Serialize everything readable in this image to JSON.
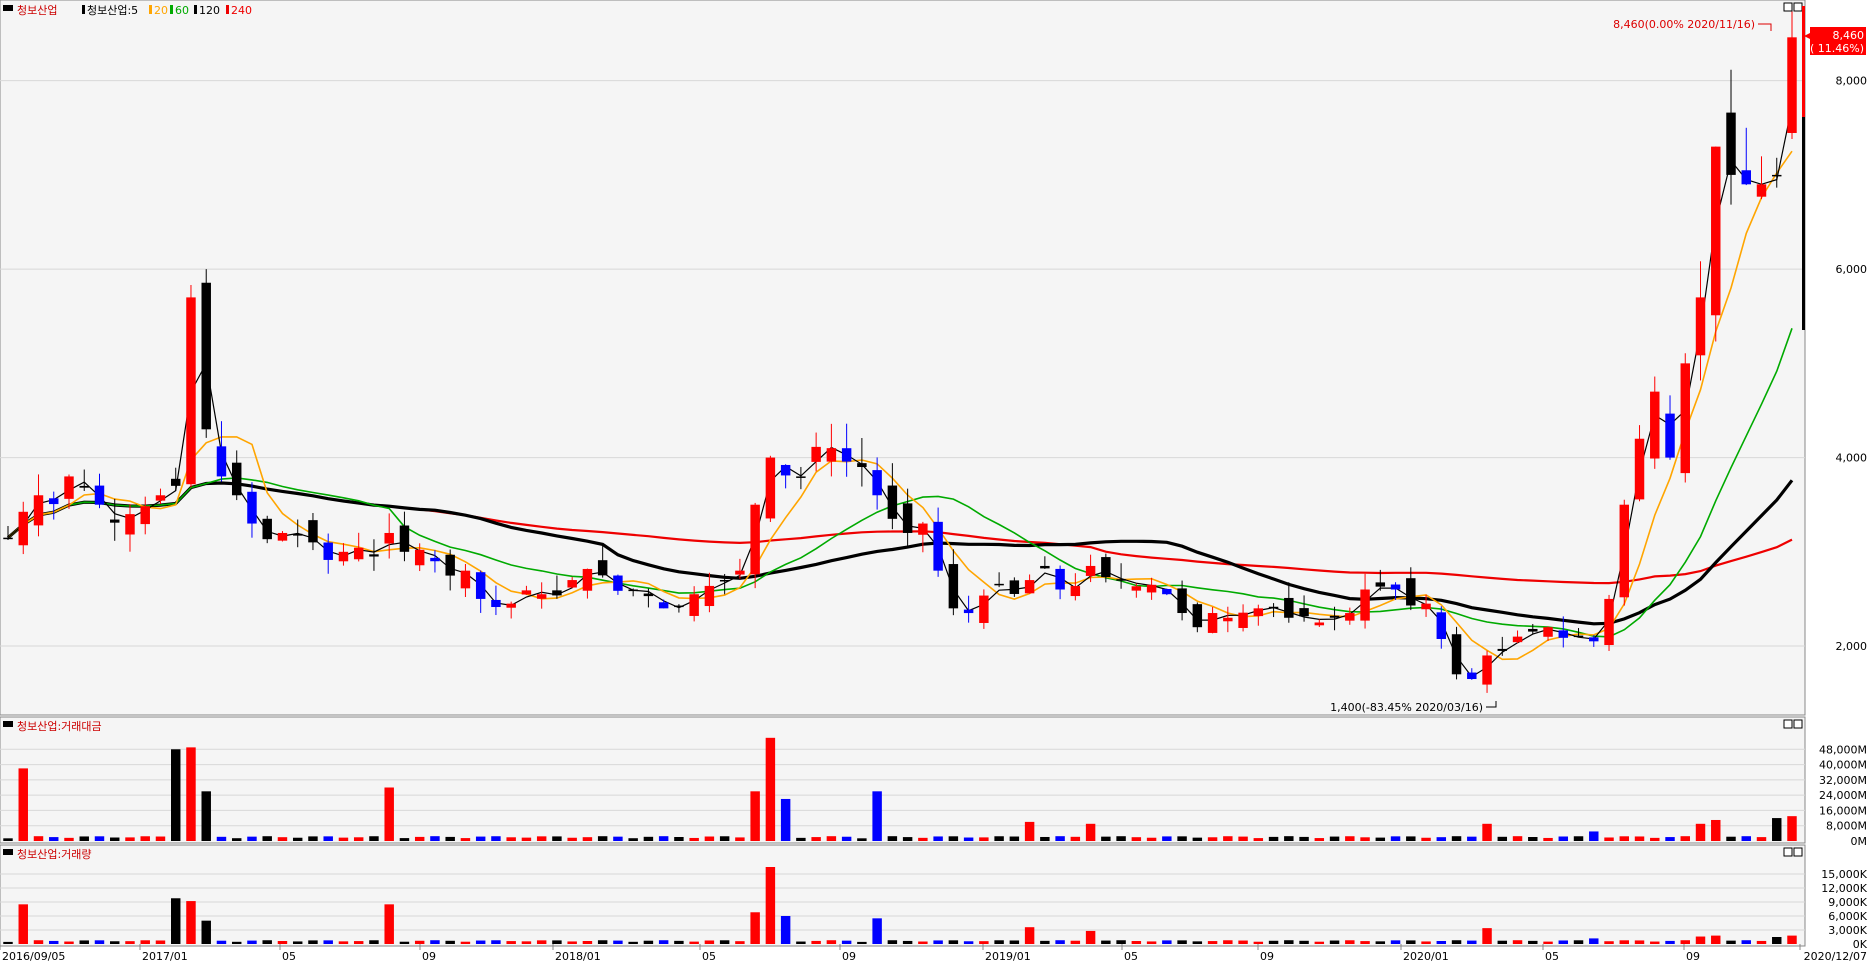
{
  "colors": {
    "up": "#ff0000",
    "down": "#0000ff",
    "neutral": "#000000",
    "ma5": "#000000",
    "ma20": "#ffa500",
    "ma60": "#00aa00",
    "ma120": "#000000",
    "ma240": "#ee0000",
    "grid": "#d8d8d8",
    "panel_bg": "#f5f5f5"
  },
  "main_panel": {
    "stock_name": "청보산업",
    "legend_ma_label": "청보산업:5",
    "legend_periods": [
      "20",
      "60",
      "120",
      "240"
    ],
    "high_annotation": "8,460(0.00% 2020/11/16)",
    "low_annotation": "1,400(-83.45% 2020/03/16)",
    "price_tag_value": "8,460",
    "price_tag_change": "( 11.46%)"
  },
  "amount_panel": {
    "title": "청보산업:거래대금"
  },
  "volume_panel": {
    "title": "청보산업:거래량"
  },
  "chart_data": [
    {
      "type": "candlestick",
      "series_name": "청보산업",
      "y_ticks": [
        "8,000",
        "6,000",
        "4,000",
        "2,000"
      ],
      "ylim": [
        1300,
        8750
      ],
      "x_labels": [
        "2016/09/05",
        "2017/01",
        "05",
        "09",
        "2018/01",
        "05",
        "09",
        "2019/01",
        "05",
        "09",
        "2020/01",
        "05",
        "09",
        "2020/12/07"
      ],
      "moving_averages": [
        "5",
        "20",
        "60",
        "120",
        "240"
      ],
      "anchors": [
        [
          0,
          3150
        ],
        [
          2,
          3600
        ],
        [
          4,
          3800
        ],
        [
          6,
          3500
        ],
        [
          8,
          3400
        ],
        [
          10,
          3600
        ],
        [
          11,
          3700
        ],
        [
          12,
          5700
        ],
        [
          13,
          4300
        ],
        [
          14,
          3800
        ],
        [
          15,
          3600
        ],
        [
          16,
          3300
        ],
        [
          18,
          3200
        ],
        [
          20,
          3100
        ],
        [
          22,
          3000
        ],
        [
          24,
          2950
        ],
        [
          25,
          3200
        ],
        [
          26,
          3000
        ],
        [
          28,
          2900
        ],
        [
          30,
          2800
        ],
        [
          31,
          2500
        ],
        [
          33,
          2450
        ],
        [
          35,
          2550
        ],
        [
          37,
          2700
        ],
        [
          39,
          2750
        ],
        [
          41,
          2600
        ],
        [
          43,
          2400
        ],
        [
          45,
          2550
        ],
        [
          47,
          2700
        ],
        [
          48,
          2800
        ],
        [
          49,
          3500
        ],
        [
          50,
          4000
        ],
        [
          52,
          3800
        ],
        [
          54,
          4100
        ],
        [
          56,
          3900
        ],
        [
          57,
          3600
        ],
        [
          58,
          3350
        ],
        [
          59,
          3200
        ],
        [
          60,
          3300
        ],
        [
          61,
          2800
        ],
        [
          62,
          2400
        ],
        [
          63,
          2350
        ],
        [
          65,
          2650
        ],
        [
          67,
          2700
        ],
        [
          68,
          2850
        ],
        [
          69,
          2600
        ],
        [
          71,
          2850
        ],
        [
          73,
          2700
        ],
        [
          75,
          2650
        ],
        [
          76,
          2550
        ],
        [
          78,
          2200
        ],
        [
          80,
          2300
        ],
        [
          82,
          2400
        ],
        [
          84,
          2300
        ],
        [
          86,
          2250
        ],
        [
          88,
          2350
        ],
        [
          89,
          2600
        ],
        [
          91,
          2600
        ],
        [
          93,
          2450
        ],
        [
          95,
          1700
        ],
        [
          96,
          1650
        ],
        [
          97,
          1900
        ],
        [
          99,
          2100
        ],
        [
          101,
          2200
        ],
        [
          103,
          2100
        ],
        [
          104,
          2050
        ],
        [
          105,
          2500
        ],
        [
          106,
          3500
        ],
        [
          107,
          4200
        ],
        [
          108,
          4700
        ],
        [
          109,
          4000
        ],
        [
          110,
          5000
        ],
        [
          111,
          5700
        ],
        [
          112,
          7300
        ],
        [
          113,
          7000
        ],
        [
          114,
          6900
        ],
        [
          115,
          6900
        ],
        [
          116,
          7000
        ],
        [
          117,
          8460
        ]
      ]
    },
    {
      "type": "bar",
      "series_name": "청보산업:거래대금",
      "y_ticks": [
        "48,000M",
        "40,000M",
        "32,000M",
        "24,000M",
        "16,000M",
        "8,000M",
        "0M"
      ],
      "ylim": [
        0,
        56000
      ],
      "spikes": [
        [
          1,
          38000
        ],
        [
          11,
          48000
        ],
        [
          12,
          49000
        ],
        [
          13,
          26000
        ],
        [
          25,
          28000
        ],
        [
          49,
          26000
        ],
        [
          50,
          54000
        ],
        [
          51,
          22000
        ],
        [
          57,
          26000
        ],
        [
          67,
          10000
        ],
        [
          71,
          9000
        ],
        [
          97,
          9000
        ],
        [
          104,
          5000
        ],
        [
          111,
          9000
        ],
        [
          112,
          11000
        ],
        [
          116,
          12000
        ],
        [
          117,
          13000
        ]
      ]
    },
    {
      "type": "bar",
      "series_name": "청보산업:거래량",
      "y_ticks": [
        "15,000K",
        "12,000K",
        "9,000K",
        "6,000K",
        "3,000K",
        "0K"
      ],
      "ylim": [
        0,
        18000
      ],
      "spikes": [
        [
          1,
          8500
        ],
        [
          11,
          9800
        ],
        [
          12,
          9200
        ],
        [
          13,
          5000
        ],
        [
          25,
          8500
        ],
        [
          49,
          6800
        ],
        [
          50,
          16500
        ],
        [
          51,
          6000
        ],
        [
          57,
          5500
        ],
        [
          67,
          3600
        ],
        [
          71,
          2800
        ],
        [
          97,
          3400
        ],
        [
          104,
          1200
        ],
        [
          111,
          1600
        ],
        [
          112,
          1800
        ],
        [
          116,
          1500
        ],
        [
          117,
          1800
        ]
      ]
    }
  ]
}
